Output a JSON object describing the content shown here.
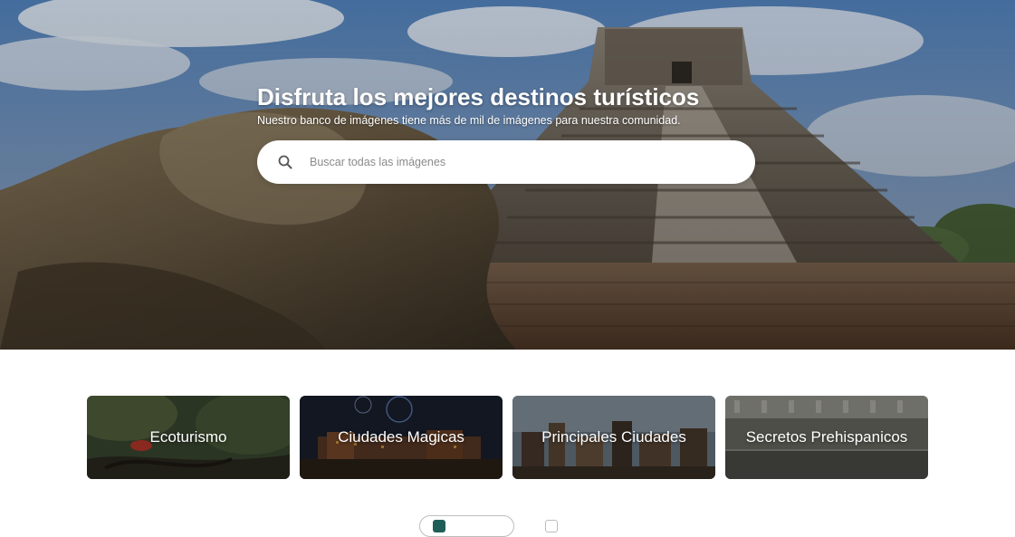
{
  "hero": {
    "title": "Disfruta los mejores destinos turísticos",
    "subtitle": "Nuestro banco de imágenes tiene más de mil de imágenes para nuestra comunidad.",
    "search_placeholder": "Buscar todas las imágenes",
    "search_icon": "search-icon"
  },
  "categories": [
    {
      "label": "Ecoturismo"
    },
    {
      "label": "Ciudades Magicas"
    },
    {
      "label": "Principales Ciudades"
    },
    {
      "label": "Secretos Prehispanicos"
    }
  ],
  "colors": {
    "accent": "#1f5e58",
    "toggle_border": "#bdbdbd"
  }
}
